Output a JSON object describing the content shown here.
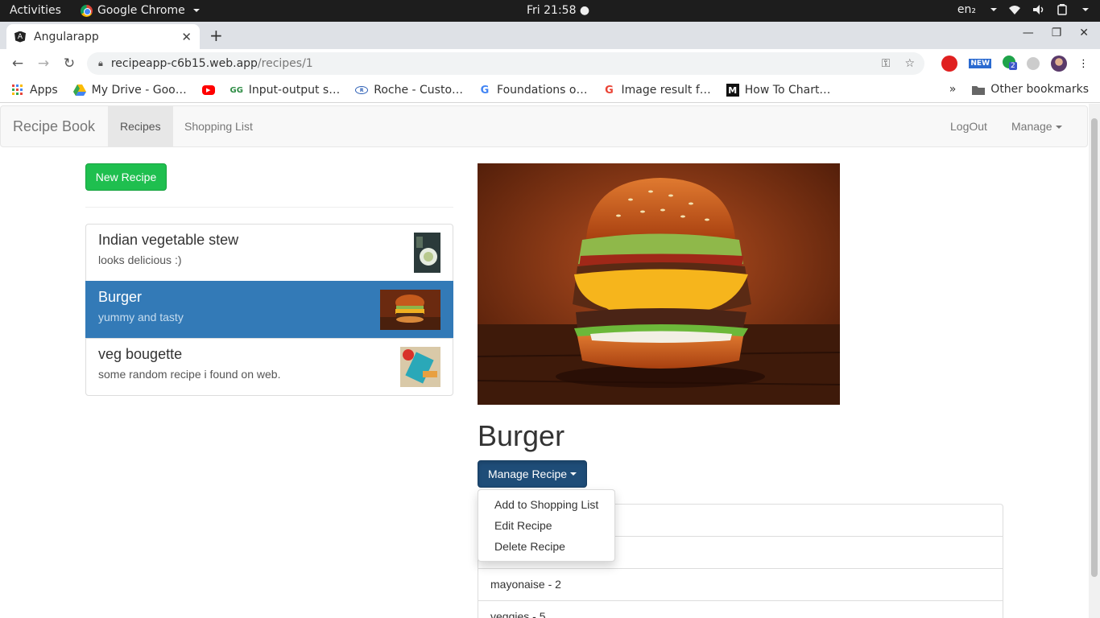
{
  "os": {
    "activities": "Activities",
    "app_name": "Google Chrome",
    "clock": "Fri 21:58 ●",
    "lang": "en₂"
  },
  "browser": {
    "tab_title": "Angularapp",
    "url_host": "recipeapp-c6b15.web.app",
    "url_path": "/recipes/1",
    "bookmarks": [
      {
        "label": "Apps",
        "icon": "apps-grid-icon"
      },
      {
        "label": "My Drive - Goo…",
        "icon": "google-drive-icon"
      },
      {
        "label": "",
        "icon": "youtube-icon"
      },
      {
        "label": "Input-output s…",
        "icon": "geeksforgeeks-icon"
      },
      {
        "label": "Roche - Custo…",
        "icon": "roche-icon"
      },
      {
        "label": "Foundations o…",
        "icon": "google-icon"
      },
      {
        "label": "Image result f…",
        "icon": "google-icon"
      },
      {
        "label": "How To Chart…",
        "icon": "medium-icon"
      }
    ],
    "other_bookmarks": "Other bookmarks",
    "ext_badge_new": "NEW",
    "ext_badge_count": "2"
  },
  "navbar": {
    "brand": "Recipe Book",
    "recipes": "Recipes",
    "shopping_list": "Shopping List",
    "logout": "LogOut",
    "manage": "Manage"
  },
  "sidebar": {
    "new_recipe": "New Recipe",
    "recipes": [
      {
        "name": "Indian vegetable stew",
        "description": "looks delicious :)",
        "active": false
      },
      {
        "name": "Burger",
        "description": "yummy and tasty",
        "active": true
      },
      {
        "name": "veg bougette",
        "description": "some random recipe i found on web.",
        "active": false
      }
    ]
  },
  "detail": {
    "title": "Burger",
    "manage_button": "Manage Recipe",
    "menu": [
      "Add to Shopping List",
      "Edit Recipe",
      "Delete Recipe"
    ],
    "ingredients": [
      "",
      "",
      "mayonaise - 2",
      "veggies - 5"
    ]
  },
  "colors": {
    "accent": "#337ab7",
    "success": "#1fbf4f",
    "manage_btn": "#1f4d78"
  }
}
